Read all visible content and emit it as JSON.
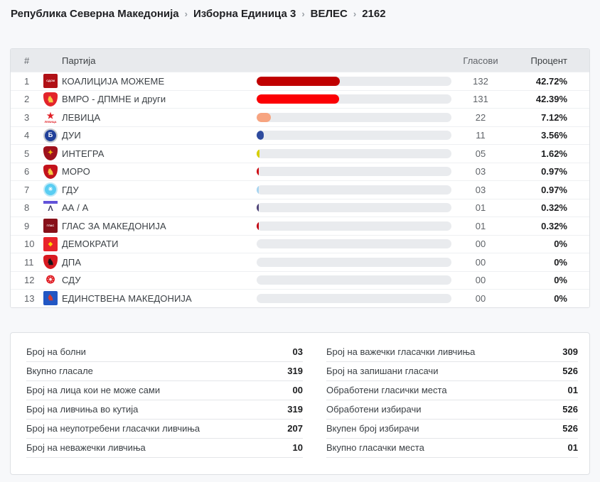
{
  "breadcrumb": {
    "separator": "›",
    "items": [
      {
        "label": "Република Северна Македонија",
        "current": false
      },
      {
        "label": "Изборна Единица 3",
        "current": false
      },
      {
        "label": "ВЕЛЕС",
        "current": false
      },
      {
        "label": "2162",
        "current": true
      }
    ]
  },
  "colors": {
    "page_background": "#f7f8fa",
    "header_row_background": "#e8eaed",
    "bar_track": "#e9ebee"
  },
  "table": {
    "header": {
      "num": "#",
      "party": "Партија",
      "votes": "Гласови",
      "percent": "Процент"
    },
    "rows": [
      {
        "num": "1",
        "party": "КОАЛИЦИЈА МОЖЕМЕ",
        "votes": "132",
        "percent": "42.72%",
        "pct": 42.72,
        "bar_color": "#c00000",
        "logo": {
          "shape": "square",
          "bg": "#b11116",
          "glyph": "СДСМ",
          "fg": "#ffffff",
          "fs": 4
        }
      },
      {
        "num": "2",
        "party": "ВМРО - ДПМНЕ и други",
        "votes": "131",
        "percent": "42.39%",
        "pct": 42.39,
        "bar_color": "#fb0004",
        "logo": {
          "shape": "shield",
          "bg": "#e3242b",
          "glyph": "♞",
          "fg": "#f6c945",
          "fs": 12
        }
      },
      {
        "num": "3",
        "party": "ЛЕВИЦА",
        "votes": "22",
        "percent": "7.12%",
        "pct": 7.12,
        "bar_color": "#f7a480",
        "logo": {
          "shape": "star",
          "glyph": "★",
          "fg": "#e01e25",
          "fs": 12,
          "sub": "ЛЕВИЦА"
        }
      },
      {
        "num": "4",
        "party": "ДУИ",
        "votes": "11",
        "percent": "3.56%",
        "pct": 3.56,
        "bar_color": "#2e4b9e",
        "logo": {
          "shape": "circle",
          "bg": "#20409a",
          "glyph": "Б",
          "fg": "#ffffff",
          "fs": 9,
          "ring": "#c3c8cf"
        }
      },
      {
        "num": "5",
        "party": "ИНТЕГРА",
        "votes": "05",
        "percent": "1.62%",
        "pct": 1.62,
        "bar_color": "#d6cf00",
        "logo": {
          "shape": "shield",
          "bg": "#9e111c",
          "glyph": "✦",
          "fg": "#f2b705",
          "fs": 10
        }
      },
      {
        "num": "6",
        "party": "МОРО",
        "votes": "03",
        "percent": "0.97%",
        "pct": 0.97,
        "bar_color": "#cf0a12",
        "logo": {
          "shape": "shield",
          "bg": "#c3121b",
          "glyph": "♞",
          "fg": "#f6c945",
          "fs": 12
        }
      },
      {
        "num": "7",
        "party": "ГДУ",
        "votes": "03",
        "percent": "0.97%",
        "pct": 0.97,
        "bar_color": "#a6d5f2",
        "logo": {
          "shape": "circle",
          "bg": "#59cdf2",
          "glyph": "✳",
          "fg": "#ffffff",
          "fs": 8,
          "ring": "#bfe9f7"
        }
      },
      {
        "num": "8",
        "party": "АА / А",
        "votes": "01",
        "percent": "0.32%",
        "pct": 0.32,
        "bar_color": "#4d4277",
        "logo": {
          "shape": "mountain",
          "bg": "#fdfdfd",
          "glyph": "Λ",
          "fg": "#3c3a5e",
          "fs": 11,
          "band": "#6252d9"
        }
      },
      {
        "num": "9",
        "party": "ГЛАС ЗА МАКЕДОНИЈА",
        "votes": "01",
        "percent": "0.32%",
        "pct": 0.32,
        "bar_color": "#c30613",
        "logo": {
          "shape": "square",
          "bg": "#871019",
          "glyph": "ГЛАС",
          "fg": "#ffffff",
          "fs": 4
        }
      },
      {
        "num": "10",
        "party": "ДЕМОКРАТИ",
        "votes": "00",
        "percent": "0%",
        "pct": 0,
        "bar_color": "",
        "logo": {
          "shape": "square",
          "bg": "#e8232b",
          "glyph": "◆",
          "fg": "#ffd200",
          "fs": 8
        }
      },
      {
        "num": "11",
        "party": "ДПА",
        "votes": "00",
        "percent": "0%",
        "pct": 0,
        "bar_color": "",
        "logo": {
          "shape": "shield",
          "bg": "#d81a21",
          "glyph": "♞",
          "fg": "#16161a",
          "fs": 12
        }
      },
      {
        "num": "12",
        "party": "СДУ",
        "votes": "00",
        "percent": "0%",
        "pct": 0,
        "bar_color": "",
        "logo": {
          "shape": "burst",
          "glyph": "❂",
          "fg": "#e01e25",
          "fs": 15
        }
      },
      {
        "num": "13",
        "party": "ЕДИНСТВЕНА МАКЕДОНИЈА",
        "votes": "00",
        "percent": "0%",
        "pct": 0,
        "bar_color": "",
        "logo": {
          "shape": "square",
          "bg": "#2257c4",
          "glyph": "♞",
          "fg": "#d23a33",
          "fs": 11
        }
      }
    ]
  },
  "stats": {
    "left": [
      {
        "label": "Број на болни",
        "value": "03"
      },
      {
        "label": "Вкупно гласале",
        "value": "319"
      },
      {
        "label": "Број на лица кои не може сами",
        "value": "00"
      },
      {
        "label": "Број на ливчиња во кутија",
        "value": "319"
      },
      {
        "label": "Број на неупотребени гласачки ливчиња",
        "value": "207"
      },
      {
        "label": "Број на неважечки ливчиња",
        "value": "10"
      }
    ],
    "right": [
      {
        "label": "Број на важечки гласачки ливчиња",
        "value": "309"
      },
      {
        "label": "Број на запишани гласачи",
        "value": "526"
      },
      {
        "label": "Обработени гласички места",
        "value": "01"
      },
      {
        "label": "Обработени избирачи",
        "value": "526"
      },
      {
        "label": "Вкупен број избирачи",
        "value": "526"
      },
      {
        "label": "Вкупно гласачки места",
        "value": "01"
      }
    ]
  }
}
